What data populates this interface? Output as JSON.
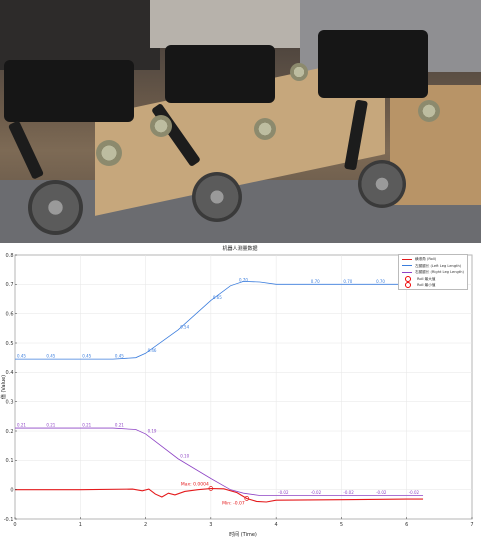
{
  "chart_data": {
    "type": "line",
    "title": "机器人测量数据",
    "xlabel": "时间 (Time)",
    "ylabel": "值 (Value)",
    "xlim": [
      0,
      7
    ],
    "ylim": [
      -0.1,
      0.8
    ],
    "xticks": [
      "0",
      "1",
      "2",
      "3",
      "4",
      "5",
      "6",
      "7"
    ],
    "yticks": [
      "-0.1",
      "0",
      "0.1",
      "0.2",
      "0.3",
      "0.4",
      "0.5",
      "0.6",
      "0.7",
      "0.8"
    ],
    "grid": true,
    "legend_position": "top-right",
    "legend": [
      "横滚角 (Roll)",
      "左腿腿长 (Left Leg Length)",
      "右腿腿长 (Right Leg Length)",
      "Roll 最大值",
      "Roll 最小值"
    ],
    "series": [
      {
        "name": "横滚角 (Roll)",
        "color": "#e41a1c",
        "x": [
          0,
          1.0,
          1.8,
          1.95,
          2.05,
          2.15,
          2.25,
          2.35,
          2.45,
          2.6,
          2.8,
          3.0,
          3.2,
          3.4,
          3.55,
          3.7,
          3.85,
          4.0,
          5.0,
          6.0,
          6.25
        ],
        "y": [
          0,
          0,
          0.002,
          -0.004,
          0.002,
          -0.015,
          -0.025,
          -0.012,
          -0.018,
          -0.006,
          0.0,
          0.004,
          0.003,
          -0.01,
          -0.03,
          -0.04,
          -0.042,
          -0.036,
          -0.034,
          -0.032,
          -0.032
        ]
      },
      {
        "name": "左腿腿长 (Left Leg Length)",
        "color": "#3b7ddd",
        "x": [
          0,
          0.5,
          1.0,
          1.5,
          1.85,
          2.0,
          2.5,
          3.0,
          3.3,
          3.5,
          3.75,
          4.0,
          4.5,
          5.0,
          5.5,
          6.0,
          6.25
        ],
        "y": [
          0.445,
          0.445,
          0.445,
          0.445,
          0.45,
          0.465,
          0.545,
          0.645,
          0.695,
          0.71,
          0.708,
          0.7,
          0.7,
          0.7,
          0.7,
          0.7,
          0.7
        ]
      },
      {
        "name": "右腿腿长 (Right Leg Length)",
        "color": "#8e44c5",
        "x": [
          0,
          0.5,
          1.0,
          1.5,
          1.85,
          2.0,
          2.5,
          3.0,
          3.3,
          3.5,
          3.75,
          4.0,
          4.5,
          5.0,
          5.5,
          6.0,
          6.25
        ],
        "y": [
          0.21,
          0.21,
          0.21,
          0.21,
          0.205,
          0.19,
          0.105,
          0.038,
          0.0,
          -0.012,
          -0.02,
          -0.02,
          -0.02,
          -0.02,
          -0.02,
          -0.02,
          -0.02
        ]
      }
    ],
    "annotations": [
      {
        "text": "Max: 0.0004",
        "x": 3.0,
        "y": 0.004,
        "color": "#e41a1c",
        "marker": "max"
      },
      {
        "text": "Min: -0.07",
        "x": 3.55,
        "y": -0.03,
        "color": "#e41a1c",
        "marker": "min"
      }
    ],
    "point_labels": [
      {
        "series": 1,
        "points": [
          [
            0,
            0.445,
            "0.45"
          ],
          [
            0.45,
            0.445,
            "0.45"
          ],
          [
            1.0,
            0.445,
            "0.45"
          ],
          [
            1.5,
            0.445,
            "0.45"
          ],
          [
            2.0,
            0.465,
            "0.46"
          ],
          [
            2.5,
            0.545,
            "0.54"
          ],
          [
            3.0,
            0.645,
            "0.65"
          ],
          [
            3.4,
            0.705,
            "0.70"
          ],
          [
            4.5,
            0.7,
            "0.70"
          ],
          [
            5.0,
            0.7,
            "0.70"
          ],
          [
            5.5,
            0.7,
            "0.70"
          ],
          [
            6.0,
            0.7,
            "0.70"
          ]
        ]
      },
      {
        "series": 2,
        "points": [
          [
            0,
            0.21,
            "0.21"
          ],
          [
            0.45,
            0.21,
            "0.21"
          ],
          [
            1.0,
            0.21,
            "0.21"
          ],
          [
            1.5,
            0.21,
            "0.21"
          ],
          [
            2.0,
            0.19,
            "0.19"
          ],
          [
            2.5,
            0.105,
            "0.10"
          ],
          [
            4.0,
            -0.02,
            "-0.02"
          ],
          [
            4.5,
            -0.02,
            "-0.02"
          ],
          [
            5.0,
            -0.02,
            "-0.02"
          ],
          [
            5.5,
            -0.02,
            "-0.02"
          ],
          [
            6.0,
            -0.02,
            "-0.02"
          ]
        ]
      }
    ]
  }
}
